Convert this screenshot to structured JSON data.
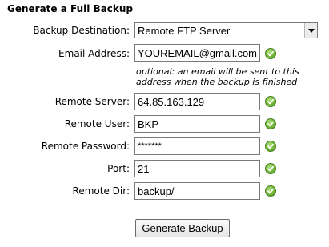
{
  "form": {
    "title": "Generate a Full Backup",
    "destination": {
      "label": "Backup Destination:",
      "selected": "Remote FTP Server"
    },
    "email": {
      "label": "Email Address:",
      "value": "YOUREMAIL@gmail.com"
    },
    "note": {
      "line1": "optional: an email will be sent to this",
      "line2": "address when the backup is finished"
    },
    "remote_server": {
      "label": "Remote Server:",
      "value": "64.85.163.129"
    },
    "remote_user": {
      "label": "Remote User:",
      "value": "BKP"
    },
    "remote_password": {
      "label": "Remote Password:",
      "value": "*******"
    },
    "port": {
      "label": "Port:",
      "value": "21"
    },
    "remote_dir": {
      "label": "Remote Dir:",
      "value": "backup/"
    },
    "submit_label": "Generate Backup",
    "valid_icon": "green-check-icon"
  }
}
